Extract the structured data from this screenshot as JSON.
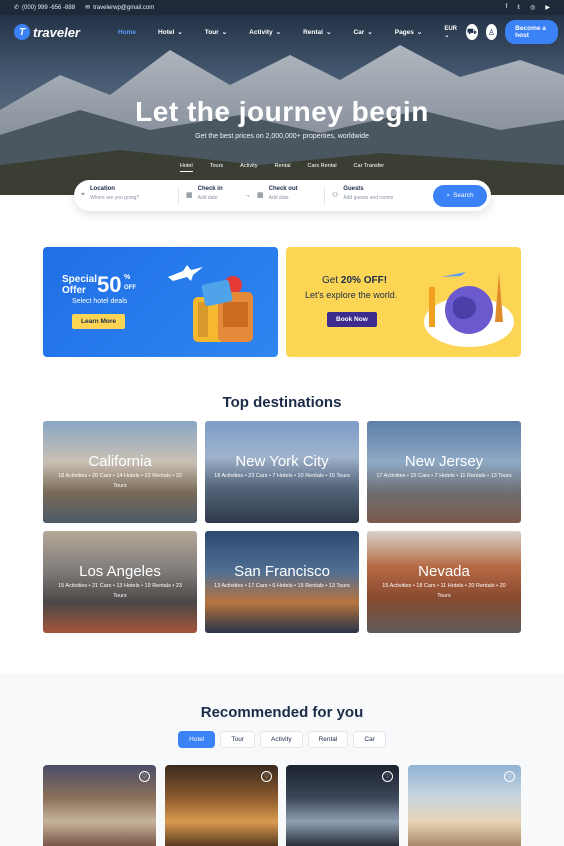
{
  "topbar": {
    "phone": "(000) 999 -656 -888",
    "email": "travelerwp@gmail.com",
    "social_icons": [
      "facebook-icon",
      "twitter-icon",
      "instagram-icon",
      "youtube-icon"
    ]
  },
  "nav": {
    "brand": "traveler",
    "items": [
      {
        "label": "Home",
        "active": true
      },
      {
        "label": "Hotel"
      },
      {
        "label": "Tour"
      },
      {
        "label": "Activity"
      },
      {
        "label": "Rental"
      },
      {
        "label": "Car"
      },
      {
        "label": "Pages"
      }
    ],
    "currency": "EUR",
    "cta": "Become a host"
  },
  "hero": {
    "title": "Let the journey begin",
    "subtitle": "Get the best prices on 2,000,000+ properties, worldwide",
    "tabs": [
      "Hotel",
      "Tours",
      "Activity",
      "Rental",
      "Cars Rental",
      "Car Transfer"
    ]
  },
  "search": {
    "location": {
      "label": "Location",
      "placeholder": "Where are you going?"
    },
    "checkin": {
      "label": "Check in",
      "placeholder": "Add date"
    },
    "checkout": {
      "label": "Check out",
      "placeholder": "Add date"
    },
    "guests": {
      "label": "Guests",
      "placeholder": "Add guests and rooms"
    },
    "button": "Search"
  },
  "promos": [
    {
      "line1": "Special",
      "line2": "Offer",
      "percent": "50",
      "pct_sign": "%",
      "off": "OFF",
      "desc": "Select hotel deals",
      "button": "Learn More"
    },
    {
      "title_pre": "Get ",
      "title_bold": "20% OFF!",
      "subtitle": "Let's explore the world.",
      "button": "Book Now"
    }
  ],
  "destinations": {
    "title": "Top destinations",
    "items": [
      {
        "name": "California",
        "stats": "18 Activities • 20 Cars • 14 Hotels • 22 Rentals • 22 Tours"
      },
      {
        "name": "New York City",
        "stats": "18 Activities • 23 Cars • 7 Hotels • 10 Rentals • 15 Tours"
      },
      {
        "name": "New Jersey",
        "stats": "17 Activities • 15 Cars • 7 Hotels • 11 Rentals • 13 Tours"
      },
      {
        "name": "Los Angeles",
        "stats": "15 Activities • 21 Cars • 13 Hotels • 19 Rentals • 23 Tours"
      },
      {
        "name": "San Francisco",
        "stats": "13 Activities • 17 Cars • 6 Hotels • 15 Rentals • 13 Tours"
      },
      {
        "name": "Nevada",
        "stats": "15 Activities • 18 Cars • 11 Hotels • 20 Rentals • 20 Tours"
      }
    ]
  },
  "recommended": {
    "title": "Recommended for you",
    "tabs": [
      {
        "label": "Hotel",
        "active": true
      },
      {
        "label": "Tour"
      },
      {
        "label": "Activity"
      },
      {
        "label": "Rental"
      },
      {
        "label": "Car"
      }
    ]
  },
  "colors": {
    "accent": "#3b82f6",
    "navy": "#1a2b48",
    "promo_yellow": "#fdd555",
    "promo_blue": "#1f6fe6"
  }
}
